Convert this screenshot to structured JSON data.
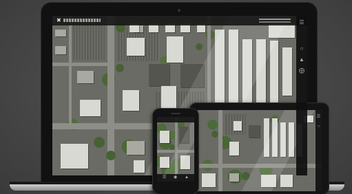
{
  "laptop": {
    "app": {
      "logo_icon": "logo-mark-icon",
      "sidebar_icons": [
        "layers-icon",
        "map-pin-icon",
        "ruler-icon",
        "target-icon"
      ]
    }
  },
  "tablet": {
    "sidebar_icons": [
      "layers-icon",
      "search-icon"
    ]
  },
  "phone": {
    "bottom_icons": [
      "menu-icon",
      "camera-icon",
      "layers-icon"
    ]
  },
  "colors": {
    "background": "#4a4a4a",
    "bezel": "#111111",
    "road": "#8e8e88",
    "roof": "#d9d9d4",
    "vegetation": "#4d6a3a"
  }
}
